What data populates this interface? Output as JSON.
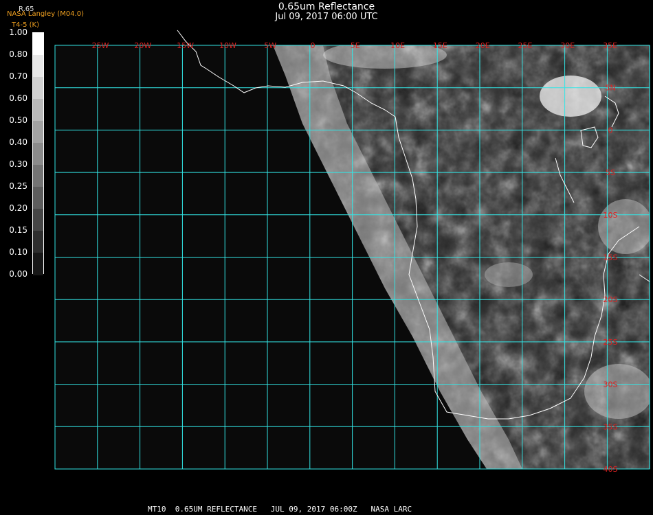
{
  "header": {
    "title": "0.65um Reflectance",
    "datetime": "Jul 09, 2017 06:00 UTC",
    "channel_label": "R.65",
    "organization": "NASA Langley (M04.0)",
    "secondary_label": "T4-5 (K)"
  },
  "colorbar": {
    "labels": [
      "1.00",
      "0.80",
      "0.70",
      "0.60",
      "0.50",
      "0.40",
      "0.30",
      "0.25",
      "0.20",
      "0.15",
      "0.10",
      "0.00"
    ]
  },
  "map": {
    "longitude_labels": [
      "25W",
      "20W",
      "15W",
      "10W",
      "5W",
      "0",
      "5E",
      "10E",
      "15E",
      "20E",
      "25E",
      "30E",
      "35E"
    ],
    "latitude_labels": [
      "5N",
      "0",
      "5S",
      "10S",
      "15S",
      "20S",
      "25S",
      "30S",
      "35S",
      "40S"
    ],
    "grid_color": "#33e6e6",
    "label_color": "#dd2222",
    "coast_color": "#ffffff"
  },
  "footer": {
    "text": "MT10  0.65UM REFLECTANCE   JUL 09, 2017 06:00Z   NASA LARC"
  }
}
